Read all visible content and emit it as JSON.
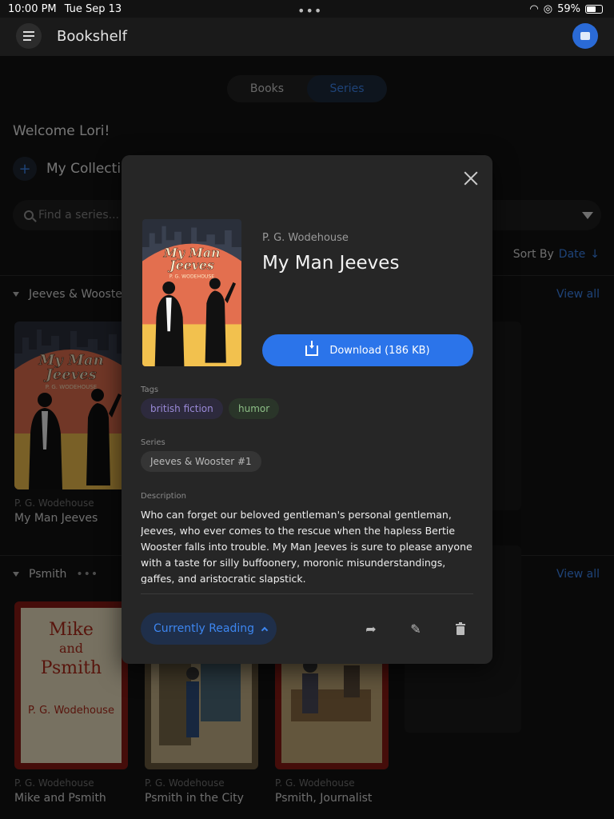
{
  "status_bar": {
    "time": "10:00 PM",
    "date": "Tue Sep 13",
    "battery": "59%"
  },
  "app": {
    "title": "Bookshelf"
  },
  "segment": {
    "books": "Books",
    "series": "Series"
  },
  "welcome": "Welcome Lori!",
  "collections_label": "My Collecti",
  "search": {
    "placeholder": "Find a series..."
  },
  "sort": {
    "label": "Sort By",
    "value": "Date",
    "arrow": "↓"
  },
  "sections": [
    {
      "name": "Jeeves & Wooster",
      "view_all": "View all"
    },
    {
      "name": "Psmith",
      "view_all": "View all"
    }
  ],
  "books": [
    {
      "author": "P. G. Wodehouse",
      "title": "My Man Jeeves"
    },
    {
      "author": "P. G. Wodehouse",
      "title": "Mike and Psmith"
    },
    {
      "author": "P. G. Wodehouse",
      "title": "Psmith in the City"
    },
    {
      "author": "P. G. Wodehouse",
      "title": "Psmith, Journalist"
    }
  ],
  "covers": {
    "jeeves_line1": "My Man",
    "jeeves_line2": "Jeeves",
    "jeeves_author": "P. G. WODEHOUSE",
    "mike_line1": "Mike",
    "mike_line2": "and",
    "mike_line3": "Psmith",
    "mike_author": "P. G. Wodehouse"
  },
  "modal": {
    "author": "P. G. Wodehouse",
    "title": "My Man Jeeves",
    "download_label": "Download (186 KB)",
    "tags_label": "Tags",
    "tags": [
      "british fiction",
      "humor"
    ],
    "series_label": "Series",
    "series_value": "Jeeves & Wooster #1",
    "description_label": "Description",
    "description": "Who can forget our beloved gentleman's personal gentleman, Jeeves, who ever comes to the rescue when the hapless Bertie Wooster falls into trouble. My Man Jeeves is sure to please anyone with a taste for silly buffoonery, moronic misunderstandings, gaffes, and aristocratic slapstick.",
    "reading_status": "Currently Reading"
  },
  "colors": {
    "accent": "#2b74ea",
    "background": "#121212",
    "modal": "#262626"
  }
}
